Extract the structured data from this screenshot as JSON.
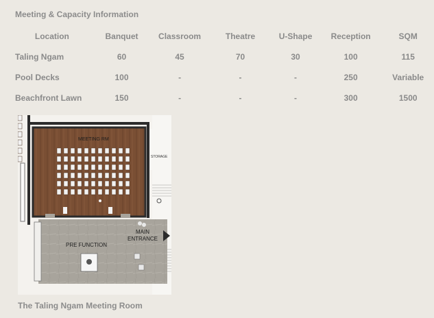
{
  "title": "Meeting & Capacity Information",
  "table": {
    "headers": [
      "Location",
      "Banquet",
      "Classroom",
      "Theatre",
      "U-Shape",
      "Reception",
      "SQM"
    ],
    "rows": [
      [
        "Taling Ngam",
        "60",
        "45",
        "70",
        "30",
        "100",
        "115"
      ],
      [
        "Pool Decks",
        "100",
        "-",
        "-",
        "-",
        "250",
        "Variable"
      ],
      [
        "Beachfront Lawn",
        "150",
        "-",
        "-",
        "-",
        "300",
        "1500"
      ]
    ]
  },
  "floorplan": {
    "meeting_room_label": "MEETING RM",
    "storage_label": "STORAGE",
    "pre_function_label": "PRE FUNCTION",
    "main_entrance_line1": "MAIN",
    "main_entrance_line2": "ENTRANCE"
  },
  "caption": "The Taling Ngam Meeting Room"
}
